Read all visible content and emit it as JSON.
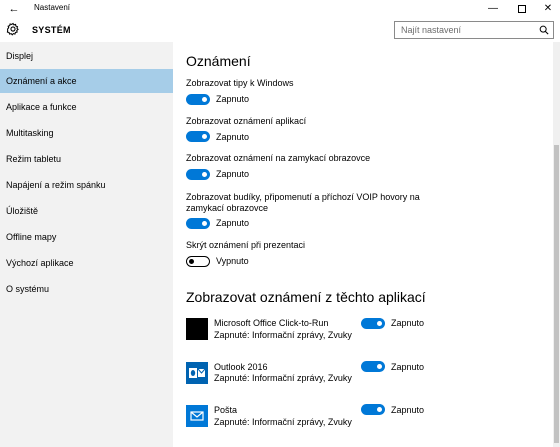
{
  "window": {
    "title": "Nastavení",
    "back_glyph": "←",
    "min_glyph": "—",
    "close_glyph": "✕"
  },
  "header": {
    "title": "SYSTÉM",
    "search_placeholder": "Najít nastavení"
  },
  "sidebar": {
    "items": [
      {
        "label": "Displej"
      },
      {
        "label": "Oznámení a akce",
        "active": true
      },
      {
        "label": "Aplikace a funkce"
      },
      {
        "label": "Multitasking"
      },
      {
        "label": "Režim tabletu"
      },
      {
        "label": "Napájení a režim spánku"
      },
      {
        "label": "Úložiště"
      },
      {
        "label": "Offline mapy"
      },
      {
        "label": "Výchozí aplikace"
      },
      {
        "label": "O systému"
      }
    ]
  },
  "main": {
    "heading": "Oznámení",
    "settings": [
      {
        "label": "Zobrazovat tipy k Windows",
        "state": "Zapnuto",
        "on": true
      },
      {
        "label": "Zobrazovat oznámení aplikací",
        "state": "Zapnuto",
        "on": true
      },
      {
        "label": "Zobrazovat oznámení na zamykací obrazovce",
        "state": "Zapnuto",
        "on": true
      },
      {
        "label_line1": "Zobrazovat budíky, připomenutí a příchozí VOIP hovory na",
        "label_line2": "zamykací obrazovce",
        "state": "Zapnuto",
        "on": true
      },
      {
        "label": "Skrýt oznámení při prezentaci",
        "state": "Vypnuto",
        "on": false
      }
    ],
    "apps_heading": "Zobrazovat oznámení z těchto aplikací",
    "apps": [
      {
        "name": "Microsoft Office Click-to-Run",
        "sub": "Zapnuté: Informační zprávy, Zvuky",
        "state": "Zapnuto",
        "icon": "office-icon"
      },
      {
        "name": "Outlook 2016",
        "sub": "Zapnuté: Informační zprávy, Zvuky",
        "state": "Zapnuto",
        "icon": "outlook-icon"
      },
      {
        "name": "Pošta",
        "sub": "Zapnuté: Informační zprávy, Zvuky",
        "state": "Zapnuto",
        "icon": "mail-icon"
      }
    ]
  },
  "colors": {
    "accent": "#0078d7",
    "sidebar_bg": "#f2f2f2",
    "sidebar_active": "#a6cde8"
  }
}
